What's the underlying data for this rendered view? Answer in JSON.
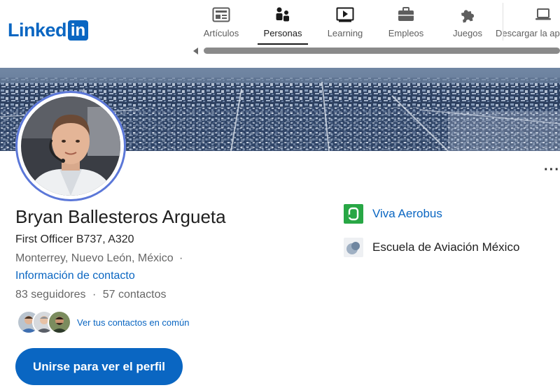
{
  "brand": {
    "logo_text": "Linked",
    "logo_box": "in",
    "color": "#0a66c2"
  },
  "nav": {
    "items": [
      {
        "label": "Artículos",
        "icon": "article-icon"
      },
      {
        "label": "Personas",
        "icon": "people-icon",
        "active": true
      },
      {
        "label": "Learning",
        "icon": "learning-icon"
      },
      {
        "label": "Empleos",
        "icon": "briefcase-icon"
      },
      {
        "label": "Juegos",
        "icon": "puzzle-icon"
      },
      {
        "label": "Descargar la apli",
        "icon": "laptop-icon"
      }
    ]
  },
  "profile": {
    "name": "Bryan Ballesteros Argueta",
    "headline": "First Officer B737, A320",
    "location": "Monterrey, Nuevo León, México",
    "location_sep": "·",
    "contact_info": "Información de contacto",
    "followers": "83 seguidores",
    "stats_sep": "·",
    "connections": "57 contactos",
    "mutual_link": "Ver tus contactos en común",
    "join_button": "Unirse para ver el perfil",
    "more_menu": "···"
  },
  "experience": [
    {
      "label": "Viva Aerobus",
      "icon": "viva-aerobus-logo",
      "color": "#28a745"
    },
    {
      "label": "Escuela de Aviación México",
      "icon": "school-logo"
    }
  ]
}
